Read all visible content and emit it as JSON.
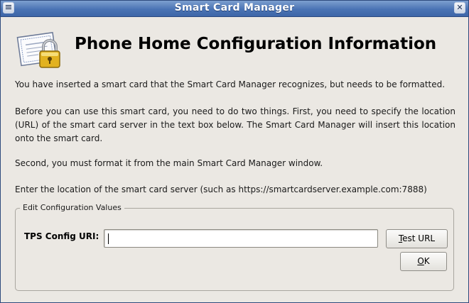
{
  "window": {
    "title": "Smart Card Manager",
    "menu_glyph": "≡",
    "close_glyph": "✕"
  },
  "header": {
    "title": "Phone Home Configuration Information",
    "icon": "certificate-lock-icon"
  },
  "body": {
    "p1": "You have inserted a smart card that the Smart Card Manager recognizes, but needs to be formatted.",
    "p2": "Before you can use this smart card, you need to do two things. First, you need to specify the location (URL) of the smart card server in the text box below. The Smart Card Manager will insert this location onto the smart card.",
    "p3": "Second, you must format it from the main Smart Card Manager window.",
    "p4": "Enter the location of the smart card server (such as https://smartcardserver.example.com:7888)"
  },
  "config": {
    "legend": "Edit Configuration Values",
    "uri_label": "TPS Config URI:",
    "uri_value": "",
    "test_mnemonic": "T",
    "test_rest": "est URL",
    "ok_mnemonic": "O",
    "ok_rest": "K"
  },
  "colors": {
    "titlebar": "#4a73b4",
    "window_bg": "#ebe8e3"
  }
}
